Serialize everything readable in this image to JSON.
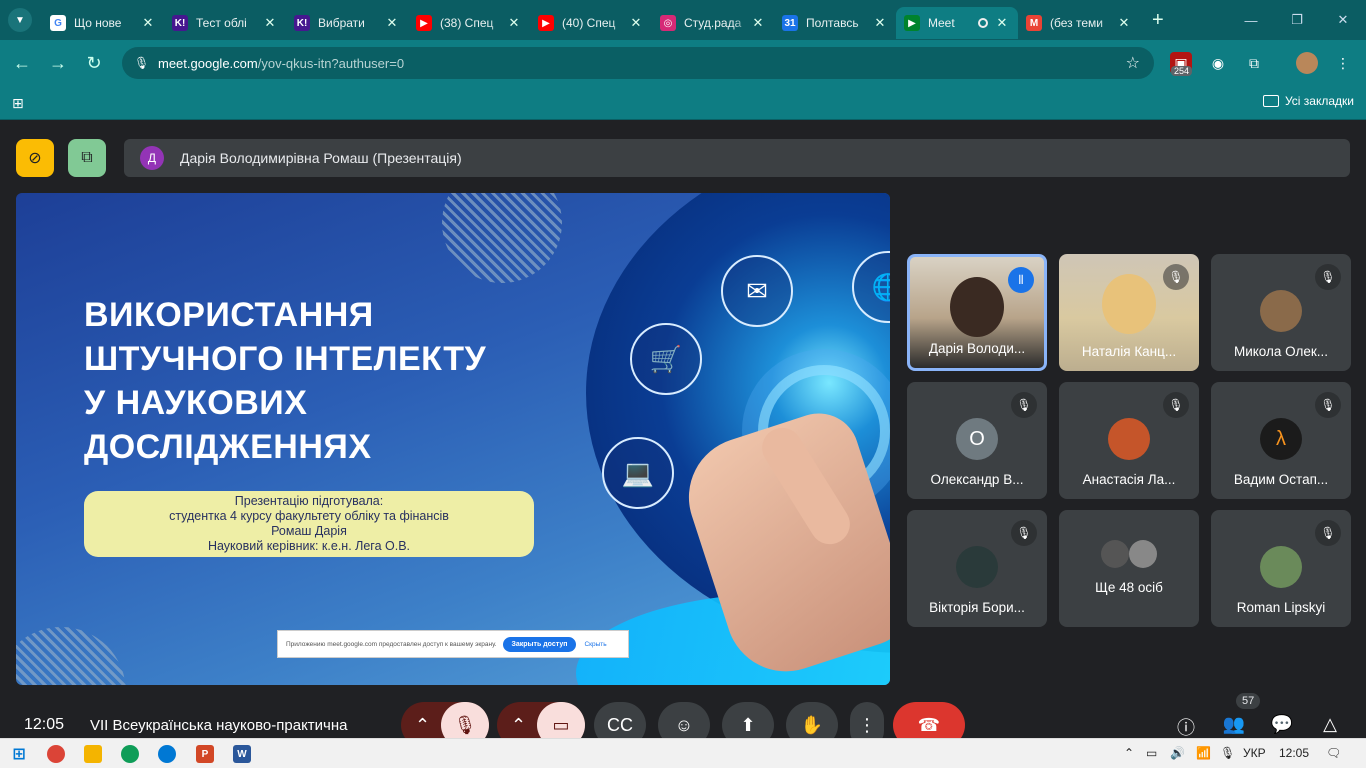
{
  "tabs": [
    {
      "title": "Що нове",
      "fav_color": "#ffffff",
      "fav_glyph": "G"
    },
    {
      "title": "Тест облі",
      "fav_color": "#46178f",
      "fav_glyph": "K!"
    },
    {
      "title": "Вибрати",
      "fav_color": "#46178f",
      "fav_glyph": "K!"
    },
    {
      "title": "(38) Спец",
      "fav_color": "#ff0000",
      "fav_glyph": "▶"
    },
    {
      "title": "(40) Спец",
      "fav_color": "#ff0000",
      "fav_glyph": "▶"
    },
    {
      "title": "Студ.рада",
      "fav_color": "#d62976",
      "fav_glyph": "◎"
    },
    {
      "title": "Полтавсь",
      "fav_color": "#1a73e8",
      "fav_glyph": "31"
    },
    {
      "title": "Meet",
      "fav_color": "#00832d",
      "fav_glyph": "▶",
      "active": true
    },
    {
      "title": "(без теми",
      "fav_color": "#ea4335",
      "fav_glyph": "M"
    }
  ],
  "address": {
    "domain": "meet.google.com",
    "path": "/yov-qkus-itn?authuser=0"
  },
  "ext_badge": "254",
  "bookmarks": {
    "all_label": "Усі закладки"
  },
  "presenter": {
    "avatar_letter": "Д",
    "label": "Дарія Володимирівна Ромаш (Презентація)"
  },
  "slide": {
    "title_lines": [
      "ВИКОРИСТАННЯ",
      "ШТУЧНОГО ІНТЕЛЕКТУ",
      "У НАУКОВИХ",
      "ДОСЛІДЖЕННЯХ"
    ],
    "info_lines": [
      "Презентацію підготувала:",
      "студентка 4 курсу факультету обліку та фінансів",
      "Ромаш Дарія",
      "Науковий керівник: к.е.н. Лега О.В."
    ],
    "notice_text": "Приложению meet.google.com предоставлен доступ к вашему экрану.",
    "notice_button": "Закрыть доступ",
    "notice_link": "Скрыть"
  },
  "participants": [
    {
      "name": "Дарія Володи...",
      "speaking": true,
      "type": "video"
    },
    {
      "name": "Наталія Канц...",
      "type": "video"
    },
    {
      "name": "Микола Олек...",
      "type": "avatar",
      "color": "#8a6a4a"
    },
    {
      "name": "Олександр В...",
      "type": "letter",
      "letter": "О",
      "color": "#6f7a80"
    },
    {
      "name": "Анастасія Ла...",
      "type": "avatar",
      "color": "#c5552a"
    },
    {
      "name": "Вадим Остап...",
      "type": "avatar",
      "color": "#1b1b1b",
      "glyph": "λ"
    },
    {
      "name": "Вікторія Бори...",
      "type": "avatar",
      "color": "#2a3a3a"
    },
    {
      "name": "Ще 48 осіб",
      "type": "more"
    },
    {
      "name": "Roman Lipskyi",
      "type": "avatar",
      "color": "#6a8a5a"
    }
  ],
  "meeting": {
    "time": "12:05",
    "title": "VII Всеукраїнська науково-практична",
    "people_count": "57"
  },
  "taskbar": {
    "lang": "УКР",
    "time": "12:05"
  }
}
